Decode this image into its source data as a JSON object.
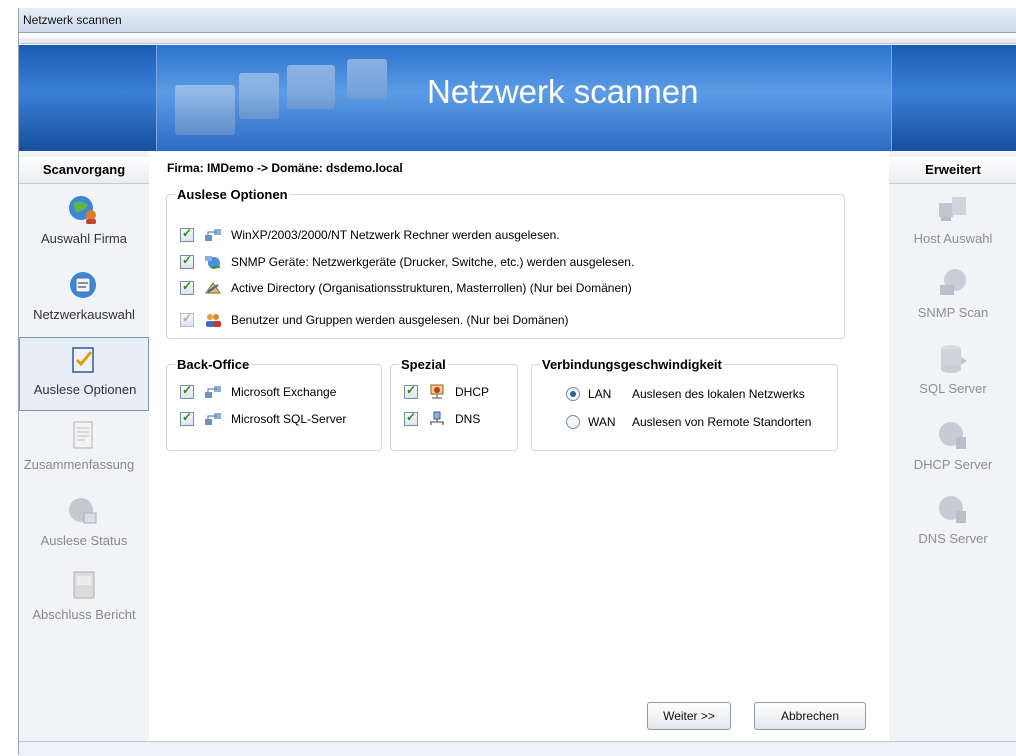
{
  "window": {
    "title": "Netzwerk scannen"
  },
  "banner": {
    "title": "Netzwerk scannen"
  },
  "left_sidebar": {
    "heading": "Scanvorgang",
    "items": [
      {
        "label": "Auswahl Firma",
        "icon": "globe-user-icon",
        "state": "normal"
      },
      {
        "label": "Netzwerkauswahl",
        "icon": "network-map-icon",
        "state": "normal"
      },
      {
        "label": "Auslese Optionen",
        "icon": "checklist-icon",
        "state": "active"
      },
      {
        "label": "Zusammenfassung",
        "icon": "document-icon",
        "state": "disabled"
      },
      {
        "label": "Auslese Status",
        "icon": "globe-status-icon",
        "state": "disabled"
      },
      {
        "label": "Abschluss Bericht",
        "icon": "report-icon",
        "state": "disabled"
      }
    ]
  },
  "right_sidebar": {
    "heading": "Erweitert",
    "items": [
      {
        "label": "Host Auswahl",
        "icon": "computers-icon"
      },
      {
        "label": "SNMP Scan",
        "icon": "globe-icon"
      },
      {
        "label": "SQL Server",
        "icon": "database-icon"
      },
      {
        "label": "DHCP Server",
        "icon": "globe-server-icon"
      },
      {
        "label": "DNS Server",
        "icon": "globe-dns-icon"
      }
    ]
  },
  "main": {
    "firma_line": "Firma: IMDemo -> Domäne: dsdemo.local",
    "auslese": {
      "legend": "Auslese Optionen",
      "options": [
        {
          "label": "WinXP/2003/2000/NT Netzwerk Rechner werden ausgelesen.",
          "checked": true,
          "enabled": true
        },
        {
          "label": "SNMP Geräte: Netzwerkgeräte (Drucker, Switche, etc.) werden ausgelesen.",
          "checked": true,
          "enabled": true
        },
        {
          "label": "Active Directory (Organisationsstrukturen, Masterrollen) (Nur bei Domänen)",
          "checked": true,
          "enabled": true
        },
        {
          "label": "Benutzer und Gruppen werden ausgelesen. (Nur bei Domänen)",
          "checked": true,
          "enabled": false
        }
      ]
    },
    "backoffice": {
      "legend": "Back-Office",
      "options": [
        {
          "label": "Microsoft Exchange",
          "checked": true
        },
        {
          "label": "Microsoft SQL-Server",
          "checked": true
        }
      ]
    },
    "spezial": {
      "legend": "Spezial",
      "options": [
        {
          "label": "DHCP",
          "checked": true
        },
        {
          "label": "DNS",
          "checked": true
        }
      ]
    },
    "speed": {
      "legend": "Verbindungsgeschwindigkeit",
      "options": [
        {
          "label": "LAN",
          "description": "Auslesen des lokalen Netzwerks",
          "selected": true
        },
        {
          "label": "WAN",
          "description": "Auslesen von Remote Standorten",
          "selected": false
        }
      ]
    },
    "buttons": {
      "next": "Weiter >>",
      "cancel": "Abbrechen"
    }
  }
}
